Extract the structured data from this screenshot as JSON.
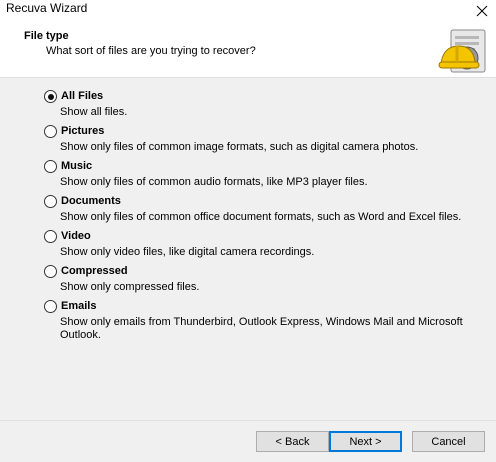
{
  "window": {
    "title": "Recuva Wizard"
  },
  "header": {
    "title": "File type",
    "subtitle": "What sort of files are you trying to recover?"
  },
  "options": [
    {
      "label": "All Files",
      "description": "Show all files.",
      "selected": true
    },
    {
      "label": "Pictures",
      "description": "Show only files of common image formats, such as digital camera photos.",
      "selected": false
    },
    {
      "label": "Music",
      "description": "Show only files of common audio formats, like MP3 player files.",
      "selected": false
    },
    {
      "label": "Documents",
      "description": "Show only files of common office document formats, such as Word and Excel files.",
      "selected": false
    },
    {
      "label": "Video",
      "description": "Show only video files, like digital camera recordings.",
      "selected": false
    },
    {
      "label": "Compressed",
      "description": "Show only compressed files.",
      "selected": false
    },
    {
      "label": "Emails",
      "description": "Show only emails from Thunderbird, Outlook Express, Windows Mail and Microsoft Outlook.",
      "selected": false
    }
  ],
  "buttons": {
    "back": "< Back",
    "next": "Next >",
    "cancel": "Cancel"
  },
  "icons": {
    "close": "close-icon",
    "header": "recuva-hardhat-icon"
  },
  "colors": {
    "default_button_border": "#0078d7",
    "header_bg": "#ffffff",
    "body_bg": "#f0f0f0"
  }
}
